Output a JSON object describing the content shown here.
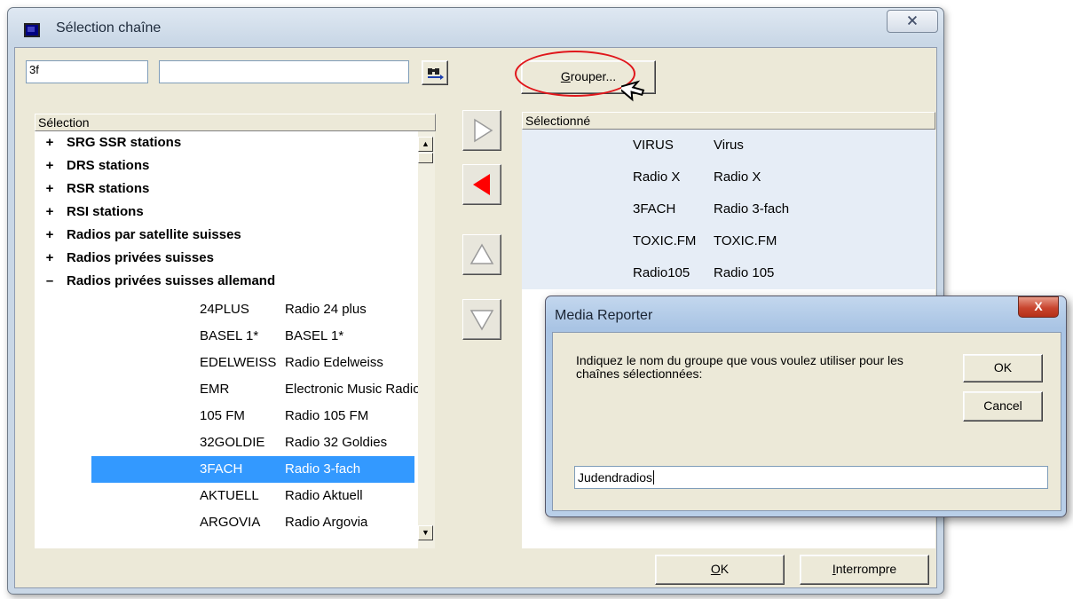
{
  "window": {
    "title": "Sélection chaîne",
    "close_glyph": "🗙"
  },
  "search": {
    "short_value": "3f",
    "long_value": ""
  },
  "find_button_icon": "binoculars-icon",
  "group_button": {
    "label_pre": "",
    "label_accel": "G",
    "label_post": "rouper..."
  },
  "left_list": {
    "header": "Sélection",
    "groups": [
      {
        "sym": "+",
        "label": "SRG SSR stations"
      },
      {
        "sym": "+",
        "label": "DRS stations"
      },
      {
        "sym": "+",
        "label": "RSR stations"
      },
      {
        "sym": "+",
        "label": "RSI stations"
      },
      {
        "sym": "+",
        "label": "Radios par satellite suisses"
      },
      {
        "sym": "+",
        "label": "Radios privées suisses"
      },
      {
        "sym": "–",
        "label": "Radios privées suisses allemand"
      }
    ],
    "rows": [
      {
        "code": "24PLUS",
        "name": "Radio 24 plus",
        "selected": false
      },
      {
        "code": "BASEL 1*",
        "name": "BASEL 1*",
        "selected": false
      },
      {
        "code": "EDELWEISS",
        "name": "Radio Edelweiss",
        "selected": false
      },
      {
        "code": "EMR",
        "name": "Electronic Music Radio",
        "selected": false
      },
      {
        "code": "105 FM",
        "name": "Radio 105 FM",
        "selected": false
      },
      {
        "code": "32GOLDIE",
        "name": "Radio 32 Goldies",
        "selected": false
      },
      {
        "code": "3FACH",
        "name": "Radio 3-fach",
        "selected": true
      },
      {
        "code": "AKTUELL",
        "name": "Radio Aktuell",
        "selected": false
      },
      {
        "code": "ARGOVIA",
        "name": "Radio Argovia",
        "selected": false
      }
    ]
  },
  "right_list": {
    "header": "Sélectionné",
    "rows": [
      {
        "code": "VIRUS",
        "name": "Virus"
      },
      {
        "code": "Radio X",
        "name": "Radio X"
      },
      {
        "code": "3FACH",
        "name": "Radio 3-fach"
      },
      {
        "code": "TOXIC.FM",
        "name": "TOXIC.FM"
      },
      {
        "code": "Radio105",
        "name": "Radio 105"
      }
    ]
  },
  "move_buttons": [
    "add-right-icon",
    "remove-left-icon",
    "move-up-icon",
    "move-down-icon"
  ],
  "bottom_buttons": {
    "ok_accel": "O",
    "ok_rest": "K",
    "cancel_accel": "I",
    "cancel_rest": "nterrompre"
  },
  "dialog": {
    "title": "Media Reporter",
    "close_glyph": "X",
    "message": "Indiquez le nom du groupe que vous voulez utiliser pour les chaînes sélectionnées:",
    "ok_label": "OK",
    "cancel_label": "Cancel",
    "input_value": "Judendradios"
  },
  "colors": {
    "selection": "#3399ff",
    "arrow_active": "#ff0000",
    "annotation": "#e0161b"
  }
}
